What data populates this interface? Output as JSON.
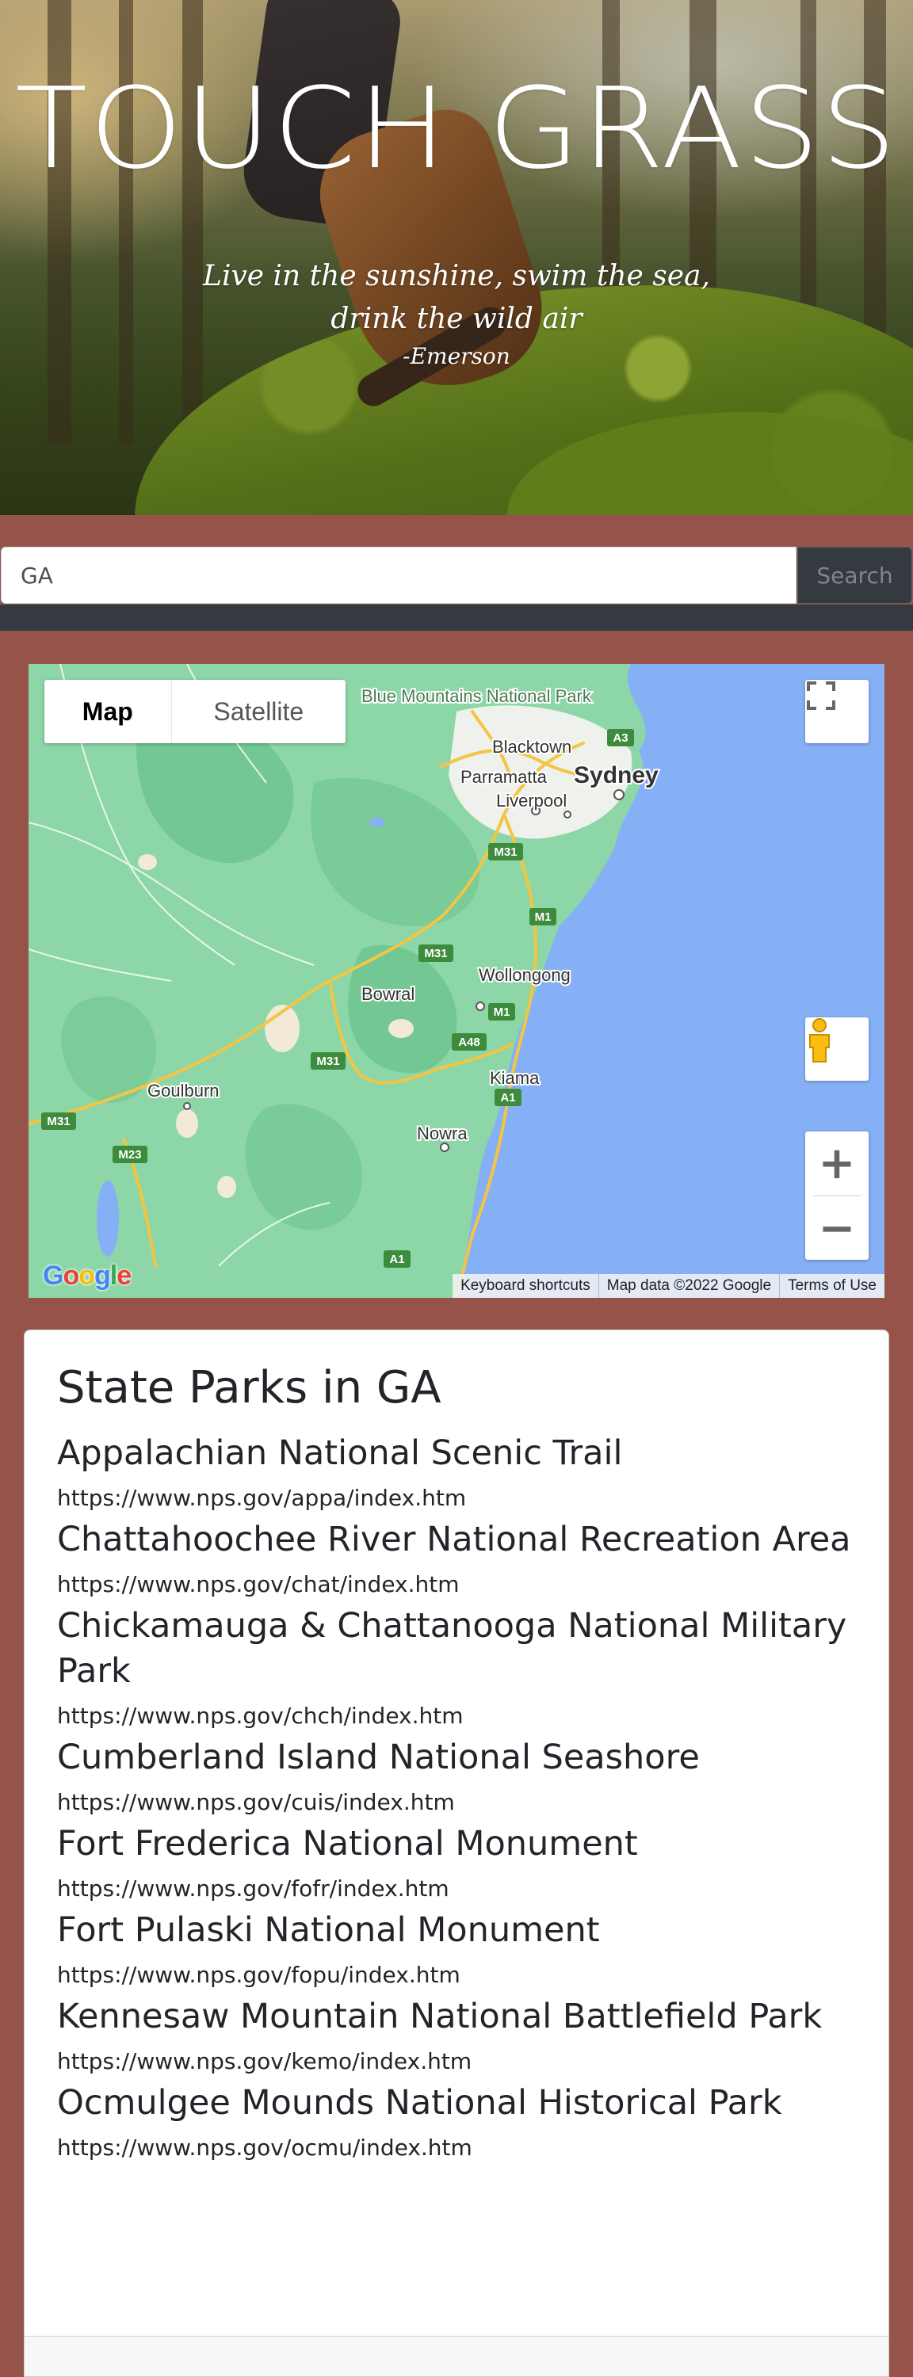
{
  "hero": {
    "title": "TOUCH GRASS",
    "quote_line1": "Live in the sunshine, swim the sea,",
    "quote_line2": "drink the wild air",
    "quote_author": "-Emerson"
  },
  "search": {
    "value": "GA",
    "button_label": "Search"
  },
  "map": {
    "type_control": {
      "map_label": "Map",
      "satellite_label": "Satellite",
      "selected": "Map"
    },
    "labels": {
      "blue_mountains": "Blue Mountains National Park",
      "blacktown": "Blacktown",
      "parramatta": "Parramatta",
      "sydney": "Sydney",
      "liverpool": "Liverpool",
      "wollongong": "Wollongong",
      "bowral": "Bowral",
      "kiama": "Kiama",
      "goulburn": "Goulburn",
      "nowra": "Nowra"
    },
    "road_shields": [
      "A3",
      "M31",
      "M1",
      "M31",
      "M1",
      "A48",
      "M31",
      "A1",
      "M31",
      "M23",
      "A1"
    ],
    "zoom_in": "+",
    "zoom_out": "−",
    "footer": {
      "shortcuts": "Keyboard shortcuts",
      "map_data": "Map data ©2022 Google",
      "terms": "Terms of Use"
    },
    "logo": "Google",
    "colors": {
      "land": "#8dd6a7",
      "water": "#86b0f5",
      "road": "#f4c542"
    }
  },
  "parks": {
    "heading": "State Parks in GA",
    "items": [
      {
        "name": "Appalachian National Scenic Trail",
        "url": "https://www.nps.gov/appa/index.htm"
      },
      {
        "name": "Chattahoochee River National Recreation Area",
        "url": "https://www.nps.gov/chat/index.htm"
      },
      {
        "name": "Chickamauga & Chattanooga National Military Park",
        "url": "https://www.nps.gov/chch/index.htm"
      },
      {
        "name": "Cumberland Island National Seashore",
        "url": "https://www.nps.gov/cuis/index.htm"
      },
      {
        "name": "Fort Frederica National Monument",
        "url": "https://www.nps.gov/fofr/index.htm"
      },
      {
        "name": "Fort Pulaski National Monument",
        "url": "https://www.nps.gov/fopu/index.htm"
      },
      {
        "name": "Kennesaw Mountain National Battlefield Park",
        "url": "https://www.nps.gov/kemo/index.htm"
      },
      {
        "name": "Ocmulgee Mounds National Historical Park",
        "url": "https://www.nps.gov/ocmu/index.htm"
      }
    ]
  },
  "theme": {
    "page_bg": "#95534a",
    "dark": "#343a40"
  }
}
